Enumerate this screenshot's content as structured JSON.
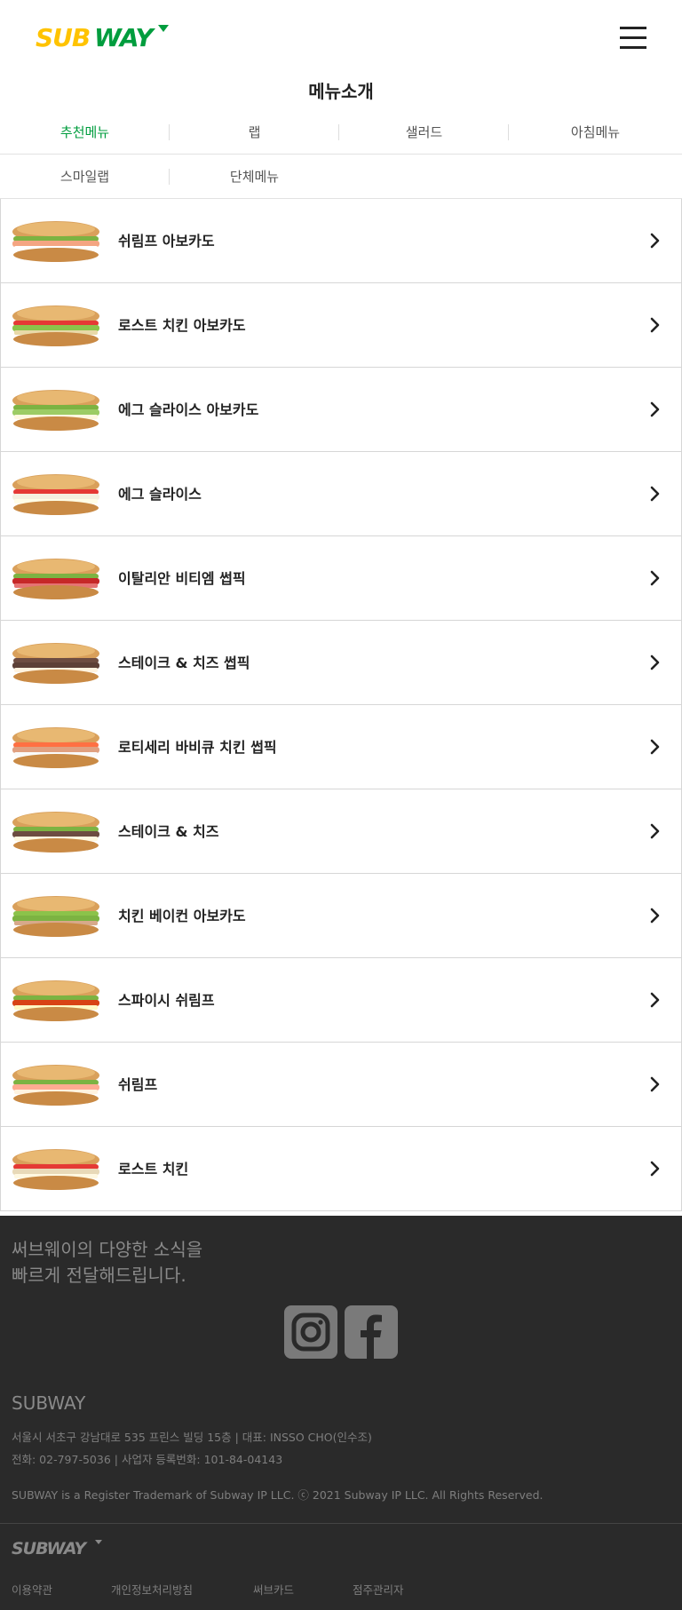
{
  "header": {
    "logo_text": "SUBWAY",
    "menu_icon": "hamburger-menu-icon"
  },
  "page_title": "메뉴소개",
  "tabs": [
    {
      "label": "추천메뉴",
      "active": true
    },
    {
      "label": "랩",
      "active": false
    },
    {
      "label": "샐러드",
      "active": false
    },
    {
      "label": "아침메뉴",
      "active": false
    },
    {
      "label": "스마일랩",
      "active": false
    },
    {
      "label": "단체메뉴",
      "active": false
    }
  ],
  "menu_items": [
    {
      "name": "쉬림프 아보카도",
      "image": "sandwich-image"
    },
    {
      "name": "로스트 치킨 아보카도",
      "image": "sandwich-image"
    },
    {
      "name": "에그 슬라이스 아보카도",
      "image": "sandwich-image"
    },
    {
      "name": "에그 슬라이스",
      "image": "sandwich-image"
    },
    {
      "name": "이탈리안 비티엠 썹픽",
      "image": "sandwich-image"
    },
    {
      "name": "스테이크 & 치즈 썹픽",
      "image": "sandwich-image"
    },
    {
      "name": "로티세리 바비큐 치킨 썹픽",
      "image": "sandwich-image"
    },
    {
      "name": "스테이크 & 치즈",
      "image": "sandwich-image"
    },
    {
      "name": "치킨 베이컨 아보카도",
      "image": "sandwich-image"
    },
    {
      "name": "스파이시 쉬림프",
      "image": "sandwich-image"
    },
    {
      "name": "쉬림프",
      "image": "sandwich-image"
    },
    {
      "name": "로스트 치킨",
      "image": "sandwich-image"
    }
  ],
  "footer": {
    "tagline_line1": "써브웨이의 다양한 소식을",
    "tagline_line2": "빠르게 전달해드립니다.",
    "social": [
      {
        "name": "instagram-icon"
      },
      {
        "name": "facebook-icon"
      }
    ],
    "brand": "SUBWAY",
    "address": "서울시 서초구 강남대로 535 프린스 빌딩 15층 | 대표: INSSO CHO(인수조)",
    "contact": "전화: 02-797-5036 | 사업자 등록번화: 101-84-04143",
    "trademark": "SUBWAY is a Register Trademark of Subway IP LLC. ⓒ 2021 Subway IP LLC. All Rights Reserved.",
    "logo_text": "SUBWAY",
    "links": [
      "이용약관",
      "개인정보처리방침",
      "써브카드",
      "점주관리자"
    ]
  },
  "colors": {
    "brand_yellow": "#ffc300",
    "brand_green": "#009d3e",
    "active_tab": "#009d3e",
    "footer_bg": "#2a2a2a"
  }
}
